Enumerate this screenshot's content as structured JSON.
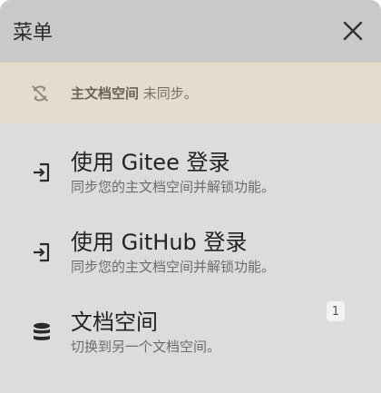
{
  "header": {
    "title": "菜单",
    "close_icon": "close-icon"
  },
  "sync_banner": {
    "icon": "sync-off-icon",
    "workspace_label": "主文档空间",
    "status": "未同步。"
  },
  "menu": {
    "items": [
      {
        "icon": "login-icon",
        "title": "使用 Gitee 登录",
        "description": "同步您的主文档空间并解锁功能。"
      },
      {
        "icon": "login-icon",
        "title": "使用 GitHub 登录",
        "description": "同步您的主文档空间并解锁功能。"
      },
      {
        "icon": "database-icon",
        "title": "文档空间",
        "description": "切换到另一个文档空间。",
        "badge": "1"
      }
    ]
  }
}
